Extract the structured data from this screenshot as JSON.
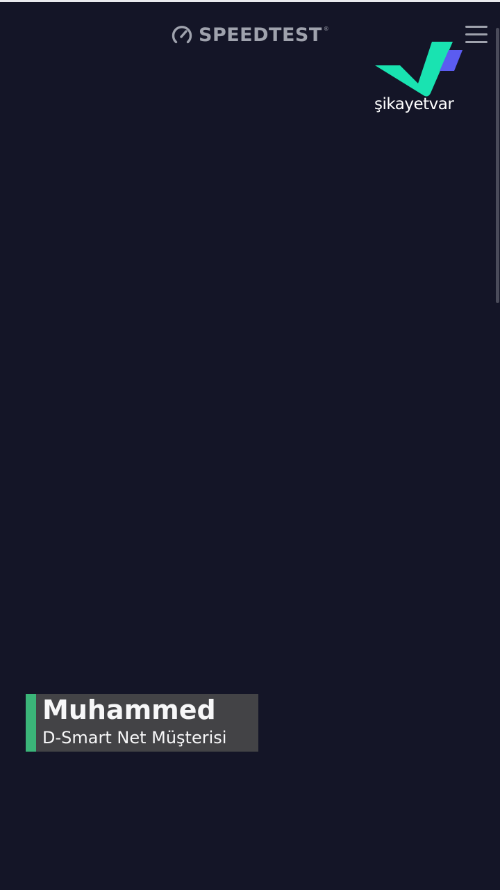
{
  "header": {
    "brand": "SPEEDTEST",
    "trademark": "®",
    "brand_icon": "speedometer-icon",
    "menu_icon": "hamburger-menu-icon"
  },
  "watermark": {
    "text": "şikayetvar",
    "logo_icon": "checkmark-logo-icon"
  },
  "caption": {
    "name": "Muhammed",
    "role": "D-Smart Net Müşterisi"
  },
  "colors": {
    "background": "#141527",
    "header_text": "#9fa2ad",
    "accent_green": "#3dbb7c",
    "logo_teal": "#19e3b1",
    "logo_purple": "#5b5cf0",
    "caption_box": "#454548",
    "caption_text": "#ffffff"
  }
}
